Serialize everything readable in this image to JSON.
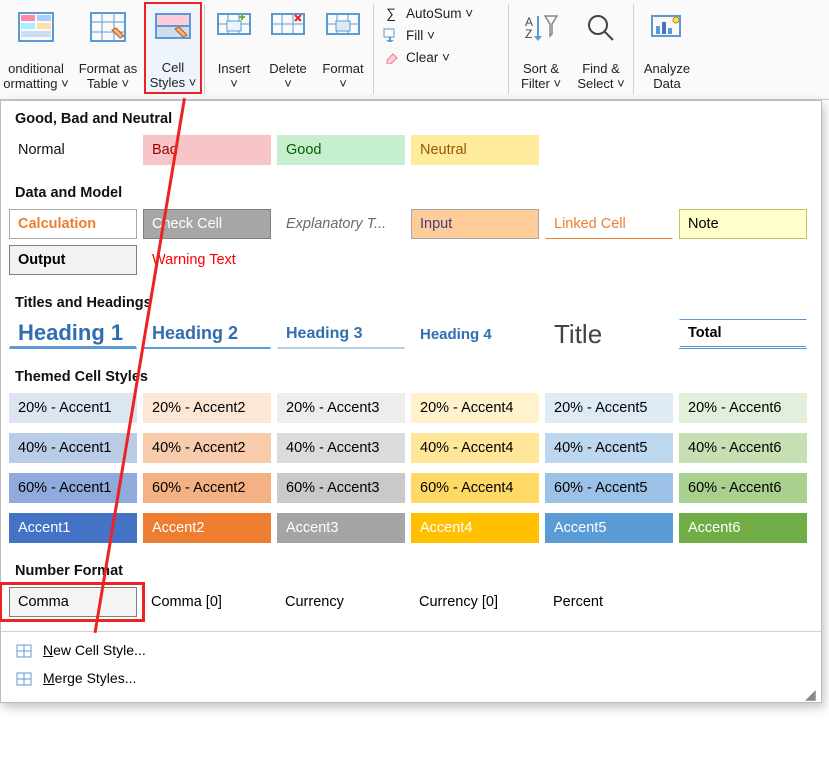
{
  "ribbon": {
    "conditional": "onditional\normatting ˅",
    "format_table": "Format as\nTable ˅",
    "cell_styles": "Cell\nStyles ˅",
    "insert": "Insert\n˅",
    "delete": "Delete\n˅",
    "format": "Format\n˅",
    "autosum": "AutoSum  ˅",
    "fill": "Fill ˅",
    "clear": "Clear ˅",
    "sort_filter": "Sort &\nFilter ˅",
    "find_select": "Find &\nSelect ˅",
    "analyze": "Analyze\nData"
  },
  "sections": {
    "good_bad": "Good, Bad and Neutral",
    "data_model": "Data and Model",
    "titles": "Titles and Headings",
    "themed": "Themed Cell Styles",
    "number": "Number Format"
  },
  "styles": {
    "normal": "Normal",
    "bad": "Bad",
    "good": "Good",
    "neutral": "Neutral",
    "calculation": "Calculation",
    "check_cell": "Check Cell",
    "explanatory": "Explanatory T...",
    "input": "Input",
    "linked_cell": "Linked Cell",
    "note": "Note",
    "output": "Output",
    "warning": "Warning Text",
    "h1": "Heading 1",
    "h2": "Heading 2",
    "h3": "Heading 3",
    "h4": "Heading 4",
    "title": "Title",
    "total": "Total"
  },
  "accents": {
    "r1": [
      "20% - Accent1",
      "20% - Accent2",
      "20% - Accent3",
      "20% - Accent4",
      "20% - Accent5",
      "20% - Accent6"
    ],
    "r2": [
      "40% - Accent1",
      "40% - Accent2",
      "40% - Accent3",
      "40% - Accent4",
      "40% - Accent5",
      "40% - Accent6"
    ],
    "r3": [
      "60% - Accent1",
      "60% - Accent2",
      "60% - Accent3",
      "60% - Accent4",
      "60% - Accent5",
      "60% - Accent6"
    ],
    "r4": [
      "Accent1",
      "Accent2",
      "Accent3",
      "Accent4",
      "Accent5",
      "Accent6"
    ]
  },
  "numfmt": {
    "comma": "Comma",
    "comma0": "Comma [0]",
    "currency": "Currency",
    "currency0": "Currency [0]",
    "percent": "Percent"
  },
  "menu": {
    "new_style_prefix": "N",
    "new_style_rest": "ew Cell Style...",
    "merge_prefix": "M",
    "merge_rest": "erge Styles..."
  }
}
